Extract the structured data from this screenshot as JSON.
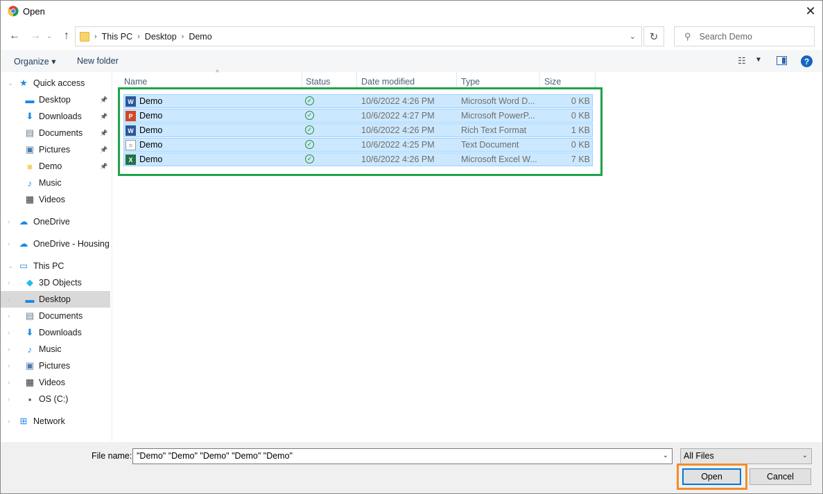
{
  "window": {
    "title": "Open"
  },
  "address": {
    "crumbs": [
      "This PC",
      "Desktop",
      "Demo"
    ]
  },
  "search": {
    "placeholder": "Search Demo"
  },
  "toolbar": {
    "organize": "Organize ▾",
    "new_folder": "New folder"
  },
  "sidebar": {
    "items": [
      {
        "label": "Quick access",
        "icon": "star-icon",
        "pinned": false
      },
      {
        "label": "Desktop",
        "icon": "desktop-icon",
        "pinned": true
      },
      {
        "label": "Downloads",
        "icon": "download-icon",
        "pinned": true
      },
      {
        "label": "Documents",
        "icon": "documents-icon",
        "pinned": true
      },
      {
        "label": "Pictures",
        "icon": "pictures-icon",
        "pinned": true
      },
      {
        "label": "Demo",
        "icon": "folder-icon",
        "pinned": true
      },
      {
        "label": "Music",
        "icon": "music-icon",
        "pinned": false
      },
      {
        "label": "Videos",
        "icon": "videos-icon",
        "pinned": false
      },
      {
        "label": "OneDrive",
        "icon": "cloud-icon",
        "pinned": false
      },
      {
        "label": "OneDrive - Housing A",
        "icon": "cloud-icon",
        "pinned": false
      },
      {
        "label": "This PC",
        "icon": "computer-icon",
        "pinned": false
      },
      {
        "label": "3D Objects",
        "icon": "cube-icon",
        "pinned": false
      },
      {
        "label": "Desktop",
        "icon": "desktop-icon",
        "pinned": false,
        "selected": true
      },
      {
        "label": "Documents",
        "icon": "documents-icon",
        "pinned": false
      },
      {
        "label": "Downloads",
        "icon": "download-icon",
        "pinned": false
      },
      {
        "label": "Music",
        "icon": "music-icon",
        "pinned": false
      },
      {
        "label": "Pictures",
        "icon": "pictures-icon",
        "pinned": false
      },
      {
        "label": "Videos",
        "icon": "videos-icon",
        "pinned": false
      },
      {
        "label": "OS (C:)",
        "icon": "drive-icon",
        "pinned": false
      },
      {
        "label": "Network",
        "icon": "network-icon",
        "pinned": false
      }
    ]
  },
  "columns": [
    "Name",
    "Status",
    "Date modified",
    "Type",
    "Size"
  ],
  "files": [
    {
      "name": "Demo",
      "date": "10/6/2022 4:26 PM",
      "type": "Microsoft Word D...",
      "size": "0 KB",
      "icon": "word-icon",
      "color": "#2b579a",
      "letter": "W"
    },
    {
      "name": "Demo",
      "date": "10/6/2022 4:27 PM",
      "type": "Microsoft PowerP...",
      "size": "0 KB",
      "icon": "powerpoint-icon",
      "color": "#d24726",
      "letter": "P"
    },
    {
      "name": "Demo",
      "date": "10/6/2022 4:26 PM",
      "type": "Rich Text Format",
      "size": "1 KB",
      "icon": "rtf-icon",
      "color": "#2b579a",
      "letter": "W"
    },
    {
      "name": "Demo",
      "date": "10/6/2022 4:25 PM",
      "type": "Text Document",
      "size": "0 KB",
      "icon": "text-document-icon",
      "color": "#ffffff",
      "letter": ""
    },
    {
      "name": "Demo",
      "date": "10/6/2022 4:26 PM",
      "type": "Microsoft Excel W...",
      "size": "7 KB",
      "icon": "excel-icon",
      "color": "#217346",
      "letter": "X"
    }
  ],
  "bottom": {
    "file_name_label": "File name:",
    "file_name_value": "\"Demo\" \"Demo\" \"Demo\" \"Demo\" \"Demo\"",
    "filter": "All Files",
    "open": "Open",
    "cancel": "Cancel"
  }
}
